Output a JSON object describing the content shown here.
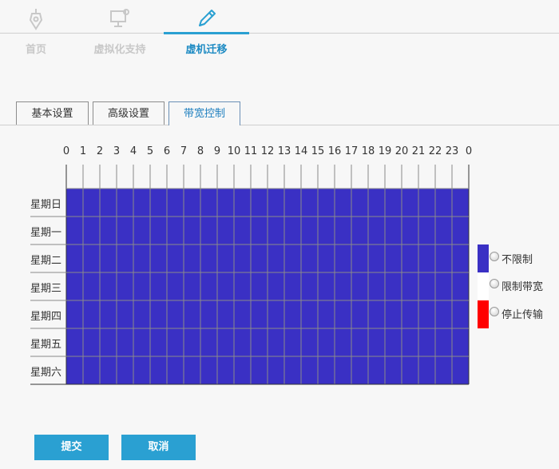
{
  "nav": {
    "items": [
      {
        "label": "首页",
        "icon": "pen-tip-icon"
      },
      {
        "label": "虚拟化支持",
        "icon": "monitor-gear-icon"
      },
      {
        "label": "虚机迁移",
        "icon": "pencil-icon"
      }
    ],
    "active_index": 2,
    "active_color": "#1e8bc3",
    "inactive_color": "#c8c8c8"
  },
  "tabs": {
    "items": [
      "基本设置",
      "高级设置",
      "带宽控制"
    ],
    "active_index": 2
  },
  "schedule": {
    "hours": [
      "0",
      "1",
      "2",
      "3",
      "4",
      "5",
      "6",
      "7",
      "8",
      "9",
      "10",
      "11",
      "12",
      "13",
      "14",
      "15",
      "16",
      "17",
      "18",
      "19",
      "20",
      "21",
      "22",
      "23",
      "0"
    ],
    "days": [
      "星期日",
      "星期一",
      "星期二",
      "星期三",
      "星期四",
      "星期五",
      "星期六"
    ],
    "cell_state": "不限制",
    "cell_color": "#3a30c4"
  },
  "legend": [
    {
      "label": "不限制",
      "color": "#3a30c4"
    },
    {
      "label": "限制带宽",
      "color": "#ffffff"
    },
    {
      "label": "停止传输",
      "color": "#ff0000"
    }
  ],
  "buttons": {
    "submit": "提交",
    "cancel": "取消"
  }
}
